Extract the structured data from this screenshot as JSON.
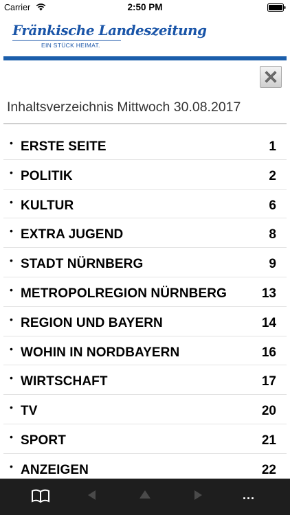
{
  "status_bar": {
    "carrier": "Carrier",
    "time": "2:50 PM"
  },
  "masthead": {
    "logo_text": "Fränkische Landeszeitung",
    "tagline": "EIN STÜCK HEIMAT.",
    "brand_color": "#1b5eab"
  },
  "toc": {
    "title": "Inhaltsverzeichnis Mittwoch 30.08.2017",
    "items": [
      {
        "label": "ERSTE SEITE",
        "page": "1"
      },
      {
        "label": "POLITIK",
        "page": "2"
      },
      {
        "label": "KULTUR",
        "page": "6"
      },
      {
        "label": "EXTRA JUGEND",
        "page": "8"
      },
      {
        "label": "STADT NÜRNBERG",
        "page": "9"
      },
      {
        "label": "METROPOLREGION NÜRNBERG",
        "page": "13"
      },
      {
        "label": "REGION UND BAYERN",
        "page": "14"
      },
      {
        "label": "WOHIN IN NORDBAYERN",
        "page": "16"
      },
      {
        "label": "WIRTSCHAFT",
        "page": "17"
      },
      {
        "label": "TV",
        "page": "20"
      },
      {
        "label": "SPORT",
        "page": "21"
      },
      {
        "label": "ANZEIGEN",
        "page": "22"
      }
    ]
  },
  "toolbar": {
    "more_label": "...",
    "icons": [
      "book-icon",
      "previous-arrow-icon",
      "up-arrow-icon",
      "next-arrow-icon",
      "more-icon"
    ]
  }
}
